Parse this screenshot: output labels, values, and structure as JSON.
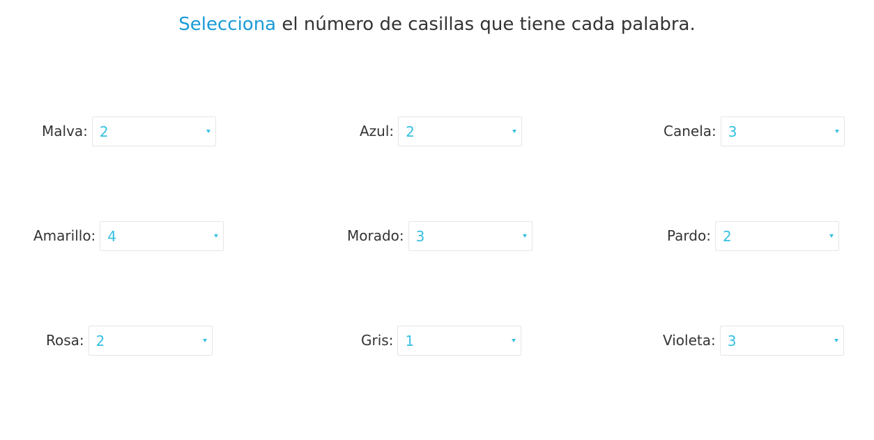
{
  "header": {
    "title_highlight": "Selecciona",
    "title_rest": " el número de casillas que tiene cada palabra."
  },
  "colors": {
    "accent": "#1a9bd7",
    "value": "#35c0e0",
    "text": "#333333",
    "border": "#e6e6e6"
  },
  "items": [
    {
      "label": "Malva:",
      "value": "2"
    },
    {
      "label": "Azul:",
      "value": "2"
    },
    {
      "label": "Canela:",
      "value": "3"
    },
    {
      "label": "Amarillo:",
      "value": "4"
    },
    {
      "label": "Morado:",
      "value": "3"
    },
    {
      "label": "Pardo:",
      "value": "2"
    },
    {
      "label": "Rosa:",
      "value": "2"
    },
    {
      "label": "Gris:",
      "value": "1"
    },
    {
      "label": "Violeta:",
      "value": "3"
    }
  ]
}
